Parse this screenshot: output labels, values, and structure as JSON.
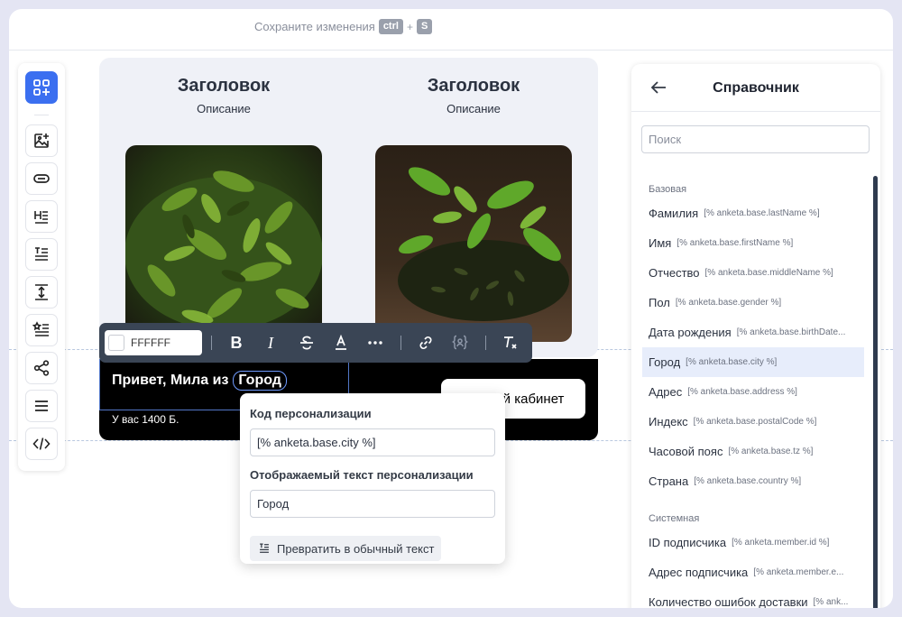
{
  "topbar": {
    "save_text": "Сохраните изменения",
    "key_ctrl": "ctrl",
    "key_plus": "+",
    "key_s": "S"
  },
  "left_toolbar": {
    "buttons": [
      "blocks-add-icon",
      "image-add-icon",
      "button-icon",
      "heading-icon",
      "text-icon",
      "spacer-icon",
      "list-icon",
      "share-icon",
      "menu-icon",
      "code-icon"
    ]
  },
  "canvas": {
    "columns": [
      {
        "title": "Заголовок",
        "description": "Описание"
      },
      {
        "title": "Заголовок",
        "description": "Описание"
      }
    ],
    "banner": {
      "greeting": "Привет, Мила из",
      "chip": "Город",
      "balance": "У вас 1400 Б.",
      "cabinet_button": "Личный кабинет"
    }
  },
  "format_toolbar": {
    "color_value": "FFFFFF",
    "color_hex": "#FFFFFF",
    "bold": "B",
    "italic": "I"
  },
  "popover": {
    "code_label": "Код персонализации",
    "code_value": "[% anketa.base.city %]",
    "display_label": "Отображаемый текст персонализации",
    "display_value": "Город",
    "convert_button": "Превратить в обычный текст"
  },
  "panel": {
    "title": "Справочник",
    "search_placeholder": "Поиск",
    "groups": [
      {
        "name": "Базовая",
        "items": [
          {
            "name": "Фамилия",
            "code": "[% anketa.base.lastName %]"
          },
          {
            "name": "Имя",
            "code": "[% anketa.base.firstName %]"
          },
          {
            "name": "Отчество",
            "code": "[% anketa.base.middleName %]"
          },
          {
            "name": "Пол",
            "code": "[% anketa.base.gender %]"
          },
          {
            "name": "Дата рождения",
            "code": "[% anketa.base.birthDate..."
          },
          {
            "name": "Город",
            "code": "[% anketa.base.city %]",
            "selected": true
          },
          {
            "name": "Адрес",
            "code": "[% anketa.base.address %]"
          },
          {
            "name": "Индекс",
            "code": "[% anketa.base.postalCode %]"
          },
          {
            "name": "Часовой пояс",
            "code": "[% anketa.base.tz %]"
          },
          {
            "name": "Страна",
            "code": "[% anketa.base.country %]"
          }
        ]
      },
      {
        "name": "Системная",
        "items": [
          {
            "name": "ID подписчика",
            "code": "[% anketa.member.id %]"
          },
          {
            "name": "Адрес подписчика",
            "code": "[% anketa.member.e..."
          },
          {
            "name": "Количество ошибок доставки",
            "code": "[% ank..."
          }
        ]
      }
    ]
  },
  "colors": {
    "accent": "#3b6ff0",
    "toolbar_bg": "#3a4555",
    "banner_bg": "#000000",
    "selected_row": "#e7edfb"
  }
}
